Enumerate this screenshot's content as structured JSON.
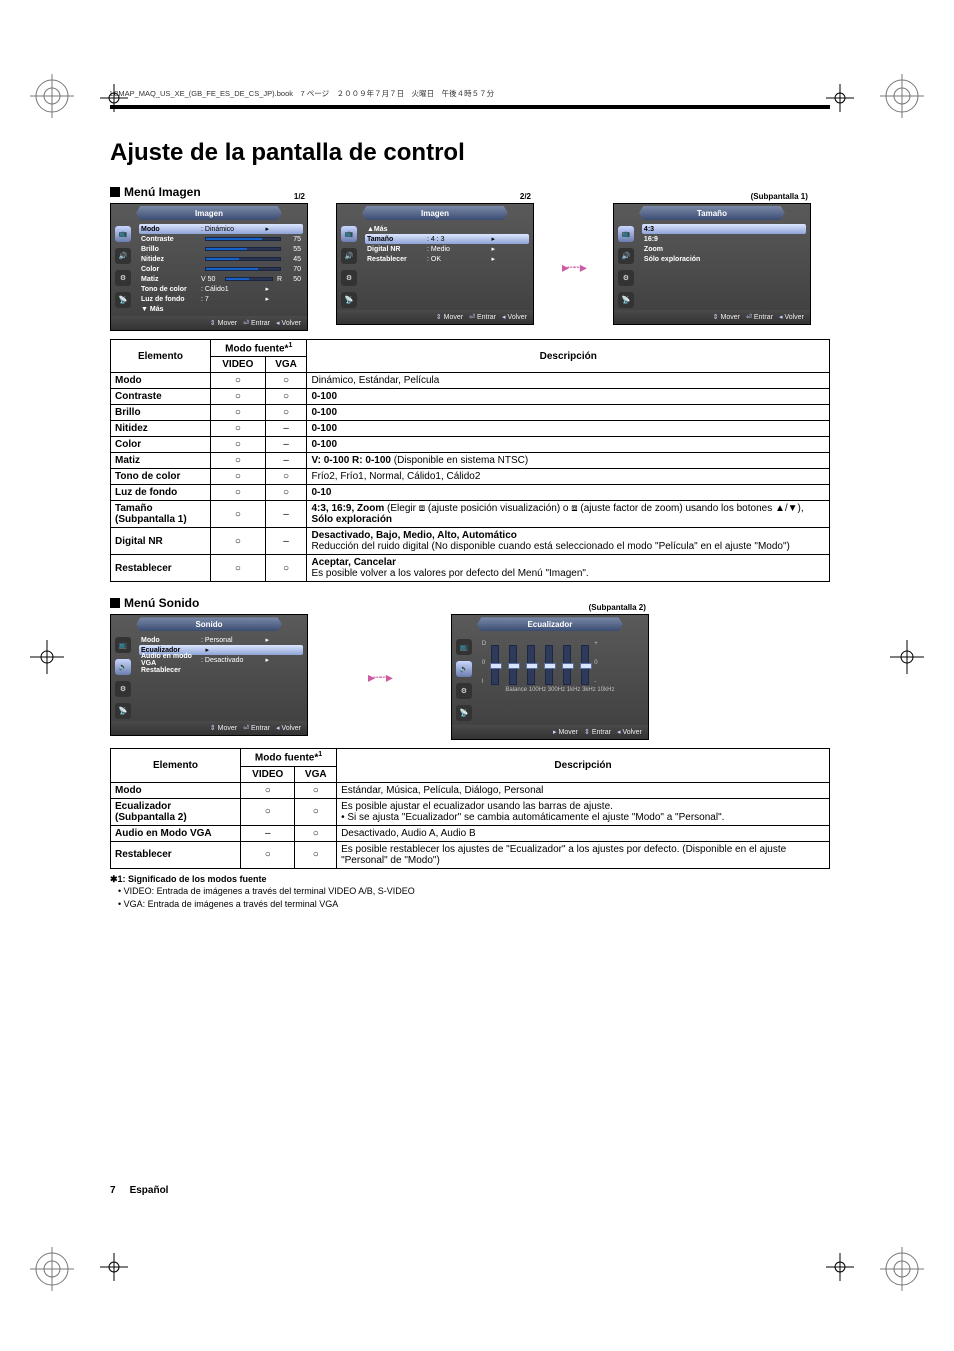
{
  "header_line": "L8MAP_MAQ_US_XE_(GB_FE_ES_DE_CS_JP).book　7 ページ　２００９年７月７日　火曜日　午後４時５７分",
  "title": "Ajuste de la pantalla de control",
  "section_image": "Menú Imagen",
  "section_sound": "Menú Sonido",
  "osd_hints": {
    "move": "Mover",
    "enter": "Entrar",
    "back": "Volver"
  },
  "osd1": {
    "page": "1/2",
    "tab": "Imagen",
    "rows": [
      {
        "label": "Modo",
        "value": ": Dinámico",
        "hl": true,
        "arrow": true
      },
      {
        "label": "Contraste",
        "bar": 75,
        "num": "75"
      },
      {
        "label": "Brillo",
        "bar": 55,
        "num": "55"
      },
      {
        "label": "Nitidez",
        "bar": 45,
        "num": "45"
      },
      {
        "label": "Color",
        "bar": 70,
        "num": "70"
      },
      {
        "label": "Matiz",
        "value": "V 50",
        "bar": 50,
        "num": "50",
        "pre": "R",
        "split": true
      },
      {
        "label": "Tono de color",
        "value": ": Cálido1",
        "arrow": true
      },
      {
        "label": "Luz de fondo",
        "value": ": 7",
        "arrow": true
      },
      {
        "label": "▼ Más"
      }
    ]
  },
  "osd2": {
    "page": "2/2",
    "tab": "Imagen",
    "rows": [
      {
        "label": "▲Más"
      },
      {
        "label": "Tamaño",
        "value": ": 4 : 3",
        "hl": true,
        "arrow": true
      },
      {
        "label": "Digital NR",
        "value": ": Medio",
        "arrow": true
      },
      {
        "label": "Restablecer",
        "value": ": OK",
        "arrow": true
      }
    ]
  },
  "osd3": {
    "sub": "(Subpantalla 1)",
    "tab": "Tamaño",
    "rows": [
      {
        "label": "4:3",
        "hl": true
      },
      {
        "label": "16:9"
      },
      {
        "label": "Zoom"
      },
      {
        "label": "Sólo exploración"
      }
    ]
  },
  "osd_sound": {
    "tab": "Sonido",
    "rows": [
      {
        "label": "Modo",
        "value": ": Personal",
        "hl": false,
        "arrow": true
      },
      {
        "label": "Ecualizador",
        "hl": true,
        "arrow": true
      },
      {
        "label": "Audio en modo VGA",
        "value": ": Desactivado",
        "arrow": true
      },
      {
        "label": "Restablecer"
      }
    ]
  },
  "osd_eq": {
    "sub": "(Subpantalla 2)",
    "tab": "Ecualizador",
    "scale_top": "D",
    "scale_mid": "0",
    "scale_bot": "I",
    "side_plus": "+",
    "side_zero": "0",
    "side_minus": "-",
    "thumbs": [
      0.5,
      0.5,
      0.5,
      0.5,
      0.5,
      0.5
    ],
    "balance_label": "Balance 100Hz  300Hz  1kHz  3kHz  10kHz"
  },
  "table_image": {
    "head": {
      "elemento": "Elemento",
      "modo": "Modo fuente*",
      "sup": "1",
      "video": "VIDEO",
      "vga": "VGA",
      "desc": "Descripción"
    },
    "rows": [
      {
        "el": "Modo",
        "v": "○",
        "g": "○",
        "d": "Dinámico, Estándar, Película"
      },
      {
        "el": "Contraste",
        "v": "○",
        "g": "○",
        "d": "0-100",
        "db": true
      },
      {
        "el": "Brillo",
        "v": "○",
        "g": "○",
        "d": "0-100",
        "db": true
      },
      {
        "el": "Nitidez",
        "v": "○",
        "g": "–",
        "d": "0-100",
        "db": true
      },
      {
        "el": "Color",
        "v": "○",
        "g": "–",
        "d": "0-100",
        "db": true
      },
      {
        "el": "Matiz",
        "v": "○",
        "g": "–",
        "d": "<b>V: 0-100 R: 0-100</b> (Disponible en sistema NTSC)"
      },
      {
        "el": "Tono de color",
        "v": "○",
        "g": "○",
        "d": "Frío2, Frío1, Normal, Cálido1, Cálido2"
      },
      {
        "el": "Luz de fondo",
        "v": "○",
        "g": "○",
        "d": "0-10",
        "db": true
      },
      {
        "el": "Tamaño<br>(Subpantalla 1)",
        "v": "○",
        "g": "–",
        "d": "<b>4:3, 16:9, Zoom</b> (Elegir ⧈ (ajuste posición visualización) o ⧈ (ajuste factor de zoom) usando los botones ▲/▼), <b>Sólo exploración</b>"
      },
      {
        "el": "Digital NR",
        "v": "○",
        "g": "–",
        "d": "<b>Desactivado, Bajo, Medio, Alto, Automático</b><br>Reducción del ruido digital (No disponible cuando está seleccionado el modo \"Película\" en el ajuste \"Modo\")"
      },
      {
        "el": "Restablecer",
        "v": "○",
        "g": "○",
        "d": "<b>Aceptar, Cancelar</b><br>Es posible volver a los valores por defecto del Menú \"Imagen\"."
      }
    ]
  },
  "table_sound": {
    "head": {
      "elemento": "Elemento",
      "modo": "Modo fuente*",
      "sup": "1",
      "video": "VIDEO",
      "vga": "VGA",
      "desc": "Descripción"
    },
    "rows": [
      {
        "el": "Modo",
        "v": "○",
        "g": "○",
        "d": "Estándar, Música, Película, Diálogo, Personal"
      },
      {
        "el": "Ecualizador<br>(Subpantalla 2)",
        "v": "○",
        "g": "○",
        "d": "Es posible ajustar el ecualizador usando las barras de ajuste.<br>• Si se ajusta \"Ecualizador\" se cambia automáticamente el ajuste \"Modo\" a \"Personal\"."
      },
      {
        "el": "Audio en Modo VGA",
        "v": "–",
        "g": "○",
        "d": "Desactivado, Audio A, Audio B"
      },
      {
        "el": "Restablecer",
        "v": "○",
        "g": "○",
        "d": "Es posible restablecer los ajustes de \"Ecualizador\" a los ajustes por defecto. (Disponible en el ajuste \"Personal\" de \"Modo\")"
      }
    ]
  },
  "notes": {
    "title": "✱1: Significado de los modos fuente",
    "l1": "VIDEO: Entrada de imágenes a través del terminal VIDEO A/B, S-VIDEO",
    "l2": "VGA: Entrada de imágenes a través del terminal VGA"
  },
  "page_number": "7",
  "page_lang": "Español"
}
